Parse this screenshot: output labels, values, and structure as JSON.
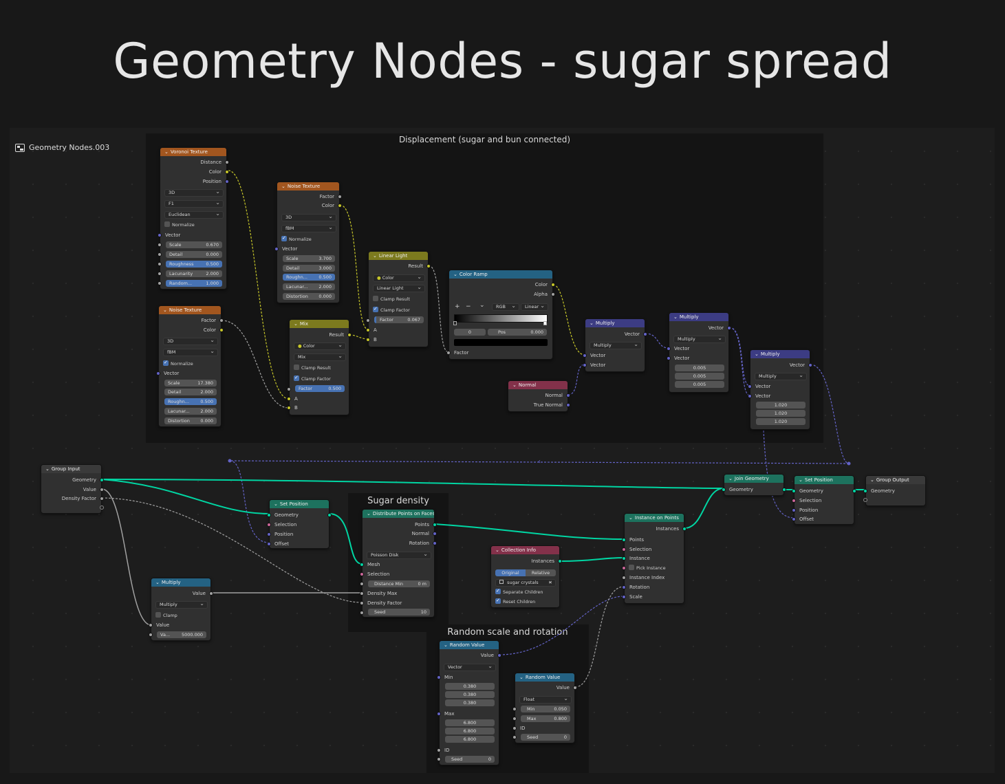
{
  "title": "Geometry Nodes - sugar spread",
  "tree_name": "Geometry Nodes.003",
  "frames": {
    "displacement": "Displacement (sugar and bun connected)",
    "sugar_density": "Sugar density",
    "random": "Random scale and rotation"
  },
  "voronoi": {
    "title": "Voronoi Texture",
    "outputs": [
      "Distance",
      "Color",
      "Position"
    ],
    "dims": "3D",
    "feature": "F1",
    "metric": "Euclidean",
    "normalize": "Normalize",
    "vector": "Vector",
    "fields": [
      [
        "Scale",
        "0.670"
      ],
      [
        "Detail",
        "0.000"
      ],
      [
        "Roughness",
        "0.500"
      ],
      [
        "Lacunarity",
        "2.000"
      ],
      [
        "Random...",
        "1.000"
      ]
    ]
  },
  "noise1": {
    "title": "Noise Texture",
    "outputs": [
      "Factor",
      "Color"
    ],
    "dims": "3D",
    "type": "fBM",
    "normalize": "Normalize",
    "vector": "Vector",
    "fields": [
      [
        "Scale",
        "3.700"
      ],
      [
        "Detail",
        "3.000"
      ],
      [
        "Roughn...",
        "0.500"
      ],
      [
        "Lacunar...",
        "2.000"
      ],
      [
        "Distortion",
        "0.000"
      ]
    ]
  },
  "noise2": {
    "title": "Noise Texture",
    "outputs": [
      "Factor",
      "Color"
    ],
    "dims": "3D",
    "type": "fBM",
    "normalize": "Normalize",
    "vector": "Vector",
    "fields": [
      [
        "Scale",
        "17.380"
      ],
      [
        "Detail",
        "2.000"
      ],
      [
        "Roughn...",
        "0.500"
      ],
      [
        "Lacunar...",
        "2.000"
      ],
      [
        "Distortion",
        "0.000"
      ]
    ]
  },
  "mix": {
    "title": "Mix",
    "output": "Result",
    "data_type": "Color",
    "blend": "Mix",
    "clamp_result": "Clamp Result",
    "clamp_factor": "Clamp Factor",
    "factor_label": "Factor",
    "factor_value": "0.500",
    "a": "A",
    "b": "B"
  },
  "linear_light": {
    "title": "Linear Light",
    "output": "Result",
    "data_type": "Color",
    "blend": "Linear Light",
    "clamp_result": "Clamp Result",
    "clamp_factor": "Clamp Factor",
    "factor_label": "Factor",
    "factor_value": "0.067",
    "a": "A",
    "b": "B"
  },
  "color_ramp": {
    "title": "Color Ramp",
    "outputs": [
      "Color",
      "Alpha"
    ],
    "mode": "RGB",
    "interp": "Linear",
    "index": "0",
    "pos_label": "Pos",
    "pos_value": "0.000",
    "input": "Factor",
    "plus": "+",
    "minus": "−",
    "more": "⌄"
  },
  "normal": {
    "title": "Normal",
    "outputs": [
      "Normal",
      "True Normal"
    ]
  },
  "mult1": {
    "title": "Multiply",
    "output": "Vector",
    "op": "Multiply",
    "inputs": [
      "Vector",
      "Vector"
    ]
  },
  "mult2": {
    "title": "Multiply",
    "output": "Vector",
    "op": "Multiply",
    "inputs": [
      "Vector",
      "Vector"
    ],
    "values": [
      "0.005",
      "0.005",
      "0.005"
    ]
  },
  "mult3": {
    "title": "Multiply",
    "output": "Vector",
    "op": "Multiply",
    "inputs": [
      "Vector",
      "Vector"
    ],
    "values": [
      "1.020",
      "1.020",
      "1.020"
    ]
  },
  "group_input": {
    "title": "Group Input",
    "outputs": [
      "Geometry",
      "Value",
      "Density Factor"
    ]
  },
  "set_pos1": {
    "title": "Set Position",
    "inputs": [
      "Geometry",
      "Selection",
      "Position",
      "Offset"
    ]
  },
  "math_mult": {
    "title": "Multiply",
    "output": "Value",
    "op": "Multiply",
    "clamp": "Clamp",
    "input": "Value",
    "field_label": "Va...",
    "field_value": "5000.000"
  },
  "distribute": {
    "title": "Distribute Points on Faces",
    "outputs": [
      "Points",
      "Normal",
      "Rotation"
    ],
    "mode": "Poisson Disk",
    "inputs": [
      "Mesh",
      "Selection"
    ],
    "dist_label": "Distance Min",
    "dist_value": "0 m",
    "inputs2": [
      "Density Max",
      "Density Factor"
    ],
    "seed_label": "Seed",
    "seed_value": "10"
  },
  "collection": {
    "title": "Collection Info",
    "output": "Instances",
    "original": "Original",
    "relative": "Relative",
    "collection": "sugar crystals",
    "separate": "Separate Children",
    "reset": "Reset Children",
    "clear": "✕"
  },
  "instance": {
    "title": "Instance on Points",
    "output": "Instances",
    "inputs": [
      "Points",
      "Selection",
      "Instance",
      "Pick Instance",
      "Instance Index",
      "Rotation",
      "Scale"
    ]
  },
  "join": {
    "title": "Join Geometry",
    "input": "Geometry"
  },
  "set_pos2": {
    "title": "Set Position",
    "inputs": [
      "Geometry",
      "Selection",
      "Position",
      "Offset"
    ]
  },
  "group_output": {
    "title": "Group Output",
    "input": "Geometry"
  },
  "rand1": {
    "title": "Random Value",
    "output": "Value",
    "type": "Vector",
    "min": "Min",
    "min_values": [
      "0.380",
      "0.380",
      "0.380"
    ],
    "max": "Max",
    "max_values": [
      "6.800",
      "6.800",
      "6.800"
    ],
    "id": "ID",
    "seed_label": "Seed",
    "seed_value": "0"
  },
  "rand2": {
    "title": "Random Value",
    "output": "Value",
    "type": "Float",
    "min_label": "Min",
    "min_value": "0.050",
    "max_label": "Max",
    "max_value": "0.800",
    "id": "ID",
    "seed_label": "Seed",
    "seed_value": "0"
  },
  "colors": {
    "geometry_link": "#00d6a3",
    "float_link": "#a1a1a1",
    "color_link": "#c7c729",
    "vector_link": "#6363c7",
    "texture_header": "#a2561f",
    "color_header": "#7c7a1e",
    "converter_header": "#246283",
    "vector_header": "#3c3c83",
    "input_header": "#83314a",
    "geometry_header": "#1d725e"
  }
}
